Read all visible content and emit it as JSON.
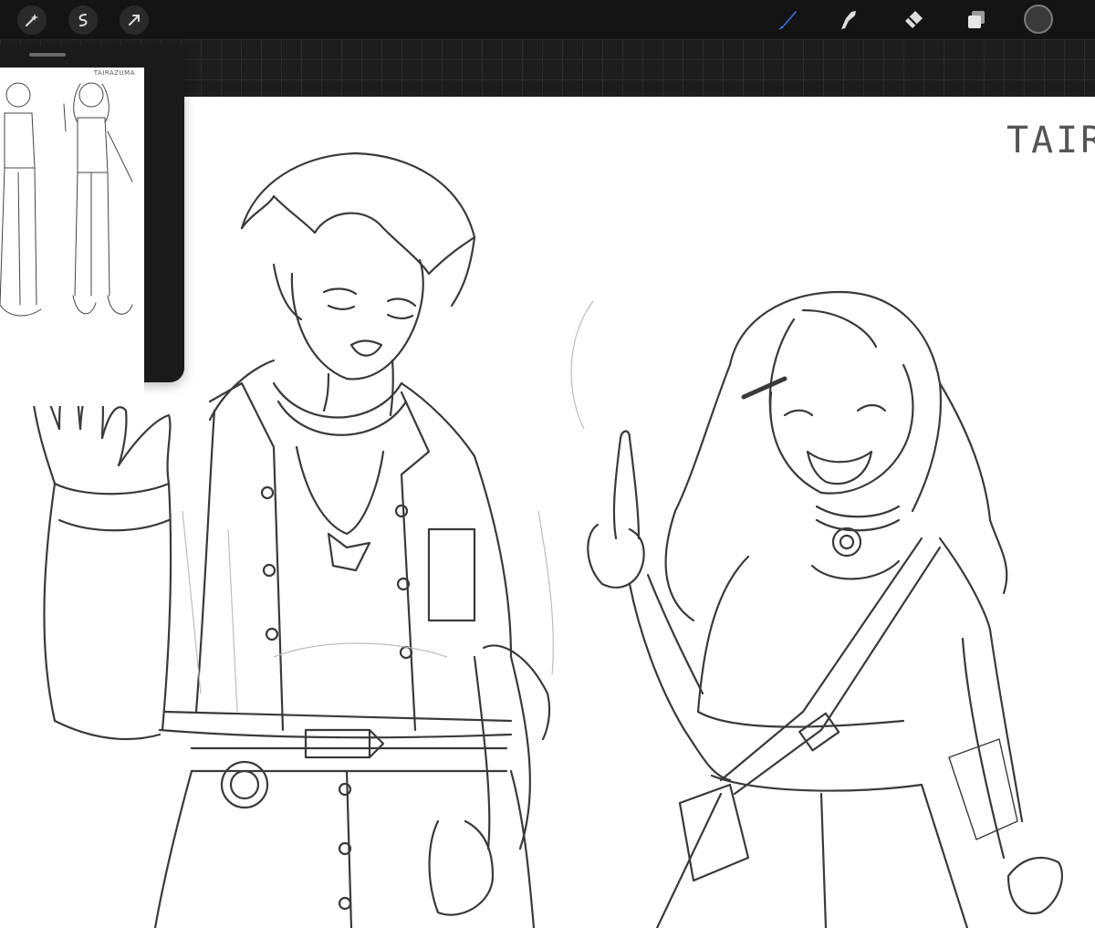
{
  "app": {
    "canvas_signature": "TAIRI",
    "reference_signature": "TAIRAZUMA",
    "accent_color": "#2f7bff",
    "current_color": "#3a3a3a"
  },
  "toolbar": {
    "left_tools": [
      {
        "name": "adjustments-icon"
      },
      {
        "name": "selection-icon"
      },
      {
        "name": "transform-icon"
      }
    ],
    "right_tools": [
      {
        "name": "brush-icon",
        "active": true
      },
      {
        "name": "smudge-icon"
      },
      {
        "name": "eraser-icon"
      },
      {
        "name": "layers-icon"
      },
      {
        "name": "color-swatch"
      }
    ]
  }
}
